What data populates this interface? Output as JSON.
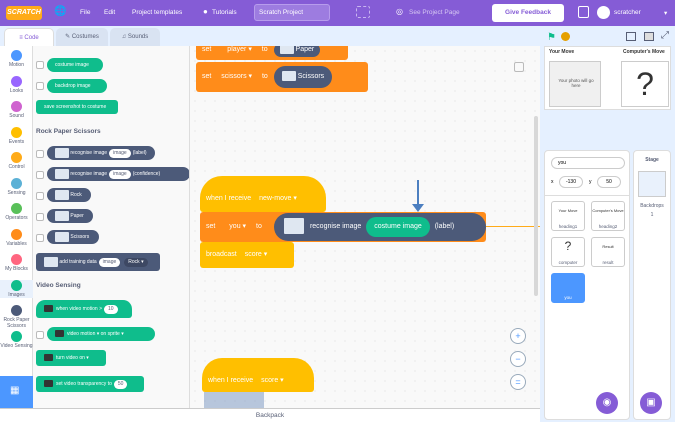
{
  "menubar": {
    "logo": "SCRATCH",
    "file": "File",
    "edit": "Edit",
    "templates": "Project templates",
    "tutorials": "Tutorials",
    "project_title": "Scratch Project",
    "see_page": "See Project Page",
    "feedback": "Give Feedback",
    "user": "scratcher"
  },
  "tabs": {
    "code": "Code",
    "costumes": "Costumes",
    "sounds": "Sounds"
  },
  "categories": [
    {
      "label": "Motion",
      "color": "#4c97ff"
    },
    {
      "label": "Looks",
      "color": "#9966ff"
    },
    {
      "label": "Sound",
      "color": "#cf63cf"
    },
    {
      "label": "Events",
      "color": "#ffbf00"
    },
    {
      "label": "Control",
      "color": "#ffab19"
    },
    {
      "label": "Sensing",
      "color": "#5cb1d6"
    },
    {
      "label": "Operators",
      "color": "#59c059"
    },
    {
      "label": "Variables",
      "color": "#ff8c1a"
    },
    {
      "label": "My Blocks",
      "color": "#ff6680"
    },
    {
      "label": "Images",
      "color": "#0fbd8c"
    },
    {
      "label": "Rock Paper Scissors",
      "color": "#4c5a79"
    },
    {
      "label": "Video Sensing",
      "color": "#0fbd8c"
    }
  ],
  "palette": {
    "costume_image": "costume image",
    "backdrop_image": "backdrop image",
    "save_screenshot": "save screenshot to costume",
    "rps_header": "Rock Paper Scissors",
    "recognise_label": "recognise image",
    "image_word": "image",
    "label_word": "(label)",
    "confidence_word": "(confidence)",
    "rock": "Rock",
    "paper": "Paper",
    "scissors": "Scissors",
    "add_training": "add training data",
    "rock_opt": "Rock",
    "video_header": "Video Sensing",
    "motion_label": "when video motion >",
    "motion_value": "10",
    "video_label": "video",
    "motion_word": "motion",
    "on_word": "on",
    "sprite_word": "sprite",
    "turn_video": "turn video",
    "on_opt": "on",
    "transparency_label": "set video transparency to",
    "transparency_value": "50"
  },
  "workspace": {
    "set1_var": "player",
    "set1_val": "Paper",
    "set_word": "set",
    "to_word": "to",
    "set2_var": "scissors",
    "set2_val": "Scissors",
    "when_receive": "when I receive",
    "msg_newmove": "new-move",
    "set3_var": "you",
    "recognise": "recognise image",
    "costume_image": "costume image",
    "label": "(label)",
    "broadcast": "broadcast",
    "msg_score": "score",
    "when_receive2": "when I receive",
    "msg_score2": "score"
  },
  "backpack": "Backpack",
  "stage": {
    "your_move": "Your Move",
    "computer_move": "Computer's Move",
    "photo_text": "Your photo will go here",
    "question": "?"
  },
  "sprite_info": {
    "name": "you",
    "x_label": "x",
    "x": "-130",
    "y_label": "y",
    "y": "50"
  },
  "sprites": [
    {
      "name": "heading1",
      "title": "Your Move"
    },
    {
      "name": "heading2",
      "title": "Computer's Move"
    },
    {
      "name": "computer",
      "glyph": "?"
    },
    {
      "name": "result",
      "title": "Result"
    },
    {
      "name": "you"
    }
  ],
  "stage_panel": {
    "title": "Stage",
    "backdrops_label": "Backdrops",
    "backdrops_count": "1"
  }
}
